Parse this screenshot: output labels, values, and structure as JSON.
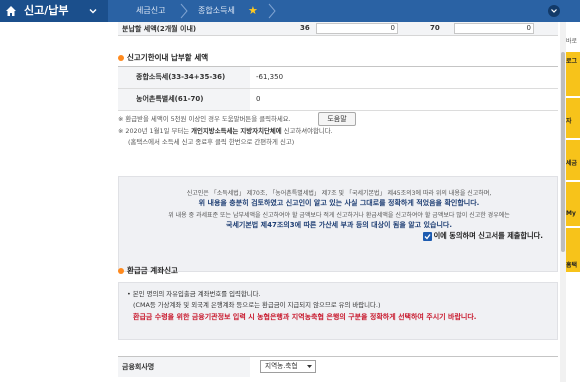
{
  "nav": {
    "menu_title": "신고/납부",
    "breadcrumbs": [
      "세금신고",
      "종합소득세"
    ]
  },
  "installment": {
    "label": "분납할 세액(2개월 이내)",
    "code1": "36",
    "value1": "0",
    "code2": "70",
    "value2": "0"
  },
  "deadline": {
    "heading": "신고기한이내 납부할 세액",
    "rows": [
      {
        "label": "종합소득세(33-34+35-36)",
        "value": "-61,350"
      },
      {
        "label": "농어촌특별세(61-70)",
        "value": "0"
      }
    ],
    "help_label": "도움말",
    "note1": "※ 환급받을 세액이 5천원 이상인 경우 도움말버튼을 클릭하세요.",
    "note2_prefix": "※ 2020년 1월1일 부터는",
    "note2_bold": "개인지방소득세는 지방자치단체에",
    "note2_suffix": "신고하셔야합니다.",
    "note3": "(홈택스에서 소득세 신고 종료후 클릭 한번으로 간편하게 신고)"
  },
  "declaration": {
    "line1": "신고인은 「소득세법」 제70조, 「농어촌특별세법」 제7조 및 「국세기본법」 제45조의3에 따라 위의 내용을 신고하며,",
    "line2": "위 내용을 충분히 검토하였고 신고인이 알고 있는 사실 그대로를 정확하게 적었음을 확인합니다.",
    "line3": "위 내용 중 과세표준 또는 납부세액을 신고하여야 할 금액보다 적게 신고하거나 환급세액을 신고하여야 할 금액보다 많이 신고한 경우에는",
    "line4": "국세기본법 제47조의3에 따른 가산세 부과 등의 대상이 됨을 알고 있습니다.",
    "agree_label": "이에 동의하며 신고서를 제출합니다."
  },
  "refund": {
    "heading": "환급금 계좌신고",
    "line1": "• 본인 명의의 자유입출금 계좌번호를 입력합니다.",
    "line2": "(CMA등 가상계좌 및 외국계 은행계좌 등으로는 환급금이 지급되지 않으므로 유의 바랍니다.)",
    "line3": "환급금 수령을 위한 금융기관정보 입력 시 농협은행과 지역농축협 은행의 구분을 정확하게 선택하여 주시기 바랍니다.",
    "bank_label": "금융회사명",
    "bank_selected": "지역농.축협"
  },
  "sidebar": {
    "head": "바로",
    "items": [
      "로그",
      "자",
      "세금",
      "My",
      "홈택"
    ]
  },
  "colors": {
    "nav_bg": "#1b4f8c",
    "bullet": "#ff8a1e",
    "warning_red": "#c8182c",
    "sidebar_yellow": "#f7c31a",
    "checkbox_blue": "#1c5bb0"
  }
}
